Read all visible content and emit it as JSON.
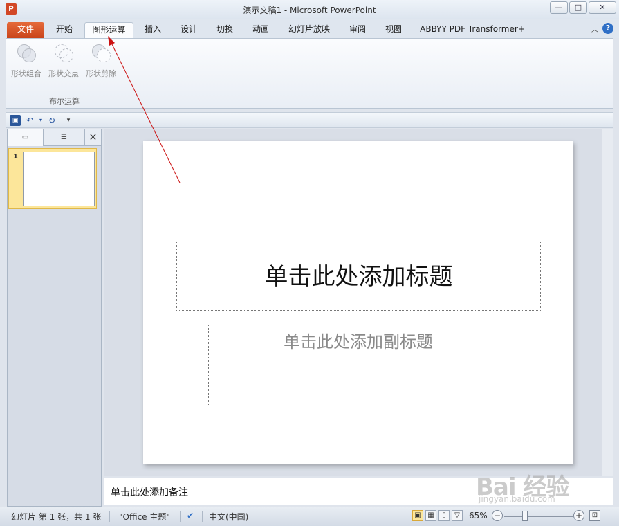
{
  "window": {
    "title": "演示文稿1 - Microsoft PowerPoint",
    "app_icon": "P",
    "minimize_label": "—",
    "maximize_label": "□",
    "close_label": "✕"
  },
  "ribbon_tabs": [
    {
      "label": "文件"
    },
    {
      "label": "开始"
    },
    {
      "label": "图形运算"
    },
    {
      "label": "插入"
    },
    {
      "label": "设计"
    },
    {
      "label": "切换"
    },
    {
      "label": "动画"
    },
    {
      "label": "幻灯片放映"
    },
    {
      "label": "审阅"
    },
    {
      "label": "视图"
    },
    {
      "label": "ABBYY PDF Transformer+"
    }
  ],
  "ribbon": {
    "group_label": "布尔运算",
    "commands": [
      {
        "label": "形状组合",
        "icon": "shape-union-icon"
      },
      {
        "label": "形状交点",
        "icon": "shape-intersect-icon"
      },
      {
        "label": "形状剪除",
        "icon": "shape-subtract-icon"
      }
    ]
  },
  "slides_pane": {
    "close_label": "✕",
    "slide_number": "1"
  },
  "slide": {
    "title_placeholder": "单击此处添加标题",
    "subtitle_placeholder": "单击此处添加副标题"
  },
  "notes": {
    "placeholder": "单击此处添加备注"
  },
  "status_bar": {
    "slide_info": "幻灯片 第 1 张，共 1 张",
    "theme": "\"Office 主题\"",
    "language": "中文(中国)",
    "zoom": "65%"
  },
  "watermark": {
    "main": "Bai 经验",
    "sub": "jingyan.baidu.com"
  },
  "colors": {
    "file_tab": "#d24726",
    "accent": "#2b579a",
    "annotation_arrow": "#cc1111"
  }
}
